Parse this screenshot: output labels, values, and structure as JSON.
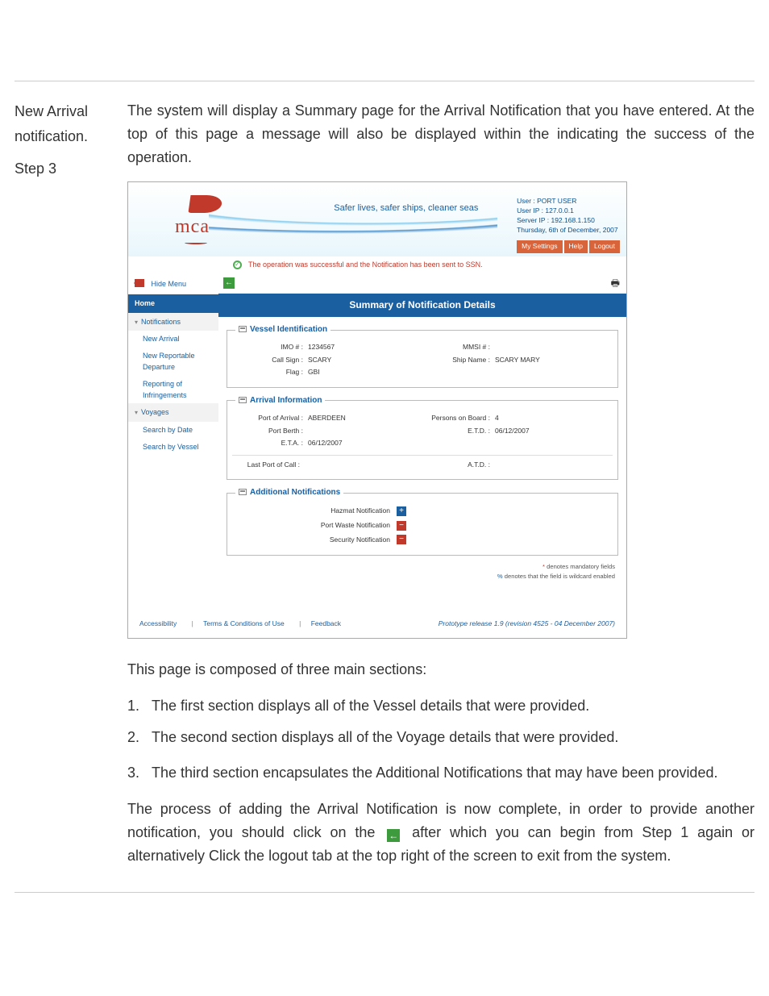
{
  "doc": {
    "side_title": "New Arrival notification.",
    "side_step": "Step 3",
    "para1": "The system will display a Summary page for the Arrival Notification that you have entered. At the top of this page a message will also be displayed within the",
    "para1b": "indicating the success of the operation.",
    "para2": "This page is composed of three main sections:",
    "li1": "The first section displays all of the Vessel details that were provided.",
    "li2": "The second section displays all of the Voyage details that were provided.",
    "li3a": "The third section encapsulates the Additional Notifications that may have been",
    "li3b": "provided.",
    "para3a": "The process of adding the Arrival Notification is now complete, in order to provide another notification, you should click on the",
    "para3b": "after which you can begin from Step 1 again or alternatively Click the logout tab at the top right of the screen to exit from the system."
  },
  "app": {
    "logo_text": "mca",
    "tagline": "Safer lives, safer ships, cleaner seas",
    "user": {
      "l1": "User : PORT USER",
      "l2": "User IP : 127.0.0.1",
      "l3": "Server IP : 192.168.1.150",
      "l4": "Thursday, 6th of December, 2007",
      "tab_settings": "My Settings",
      "tab_help": "Help",
      "tab_logout": "Logout"
    },
    "message": "The operation was successful and the Notification has been sent to SSN.",
    "side": {
      "hide_menu": "Hide Menu",
      "home": "Home",
      "sec_notifications": "Notifications",
      "new_arrival": "New Arrival",
      "new_reportable": "New Reportable Departure",
      "reporting": "Reporting of Infringements",
      "sec_voyages": "Voyages",
      "search_date": "Search by Date",
      "search_vessel": "Search by Vessel"
    },
    "banner": "Summary of Notification Details",
    "vessel": {
      "legend": "Vessel Identification",
      "imo_l": "IMO # :",
      "imo_v": "1234567",
      "callsign_l": "Call Sign :",
      "callsign_v": "SCARY",
      "flag_l": "Flag :",
      "flag_v": "GBI",
      "mmsi_l": "MMSI # :",
      "mmsi_v": "",
      "shipname_l": "Ship Name :",
      "shipname_v": "SCARY MARY"
    },
    "arrival": {
      "legend": "Arrival Information",
      "poa_l": "Port of Arrival :",
      "poa_v": "ABERDEEN",
      "berth_l": "Port Berth :",
      "berth_v": "",
      "eta_l": "E.T.A. :",
      "eta_v": "06/12/2007",
      "persons_l": "Persons on Board :",
      "persons_v": "4",
      "etd_l": "E.T.D. :",
      "etd_v": "06/12/2007",
      "lpc_l": "Last Port of Call :",
      "lpc_v": "",
      "atd_l": "A.T.D. :",
      "atd_v": ""
    },
    "notifs": {
      "legend": "Additional Notifications",
      "hazmat": "Hazmat Notification",
      "waste": "Port Waste Notification",
      "security": "Security Notification"
    },
    "legendnote1": "* denotes mandatory fields",
    "legendnote2": "% denotes that the field is wildcard enabled",
    "footer": {
      "access": "Accessibility",
      "terms": "Terms & Conditions of Use",
      "feedback": "Feedback",
      "release": "Prototype release 1.9 (revision 4525 - 04 December 2007)"
    }
  }
}
